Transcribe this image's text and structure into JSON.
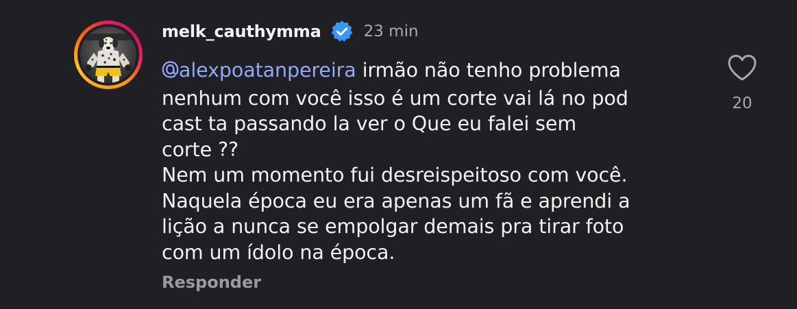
{
  "comment": {
    "username": "melk_cauthymma",
    "verified": true,
    "time": "23 min",
    "mention": "alexpoatanpereira",
    "mention_prefix_icon": "threads-at-icon",
    "lines": [
      "irmão não tenho problema",
      "nenhum com você isso é um corte vai lá no pod",
      "cast ta passando la ver o Que eu falei sem",
      "corte ??",
      "Nem um momento fui desreispeitoso com você.",
      "Naquela época eu era apenas um fã e aprendi a",
      "lição a nunca se empolgar demais pra tirar foto",
      "com um ídolo na época."
    ],
    "reply_label": "Responder",
    "like_icon": "heart-outline-icon",
    "like_count": "20"
  },
  "colors": {
    "background": "#1f1f24",
    "text": "#f2f2f2",
    "muted": "#a8a8ad",
    "mention": "#93a8f8",
    "verified": "#3897f0"
  }
}
